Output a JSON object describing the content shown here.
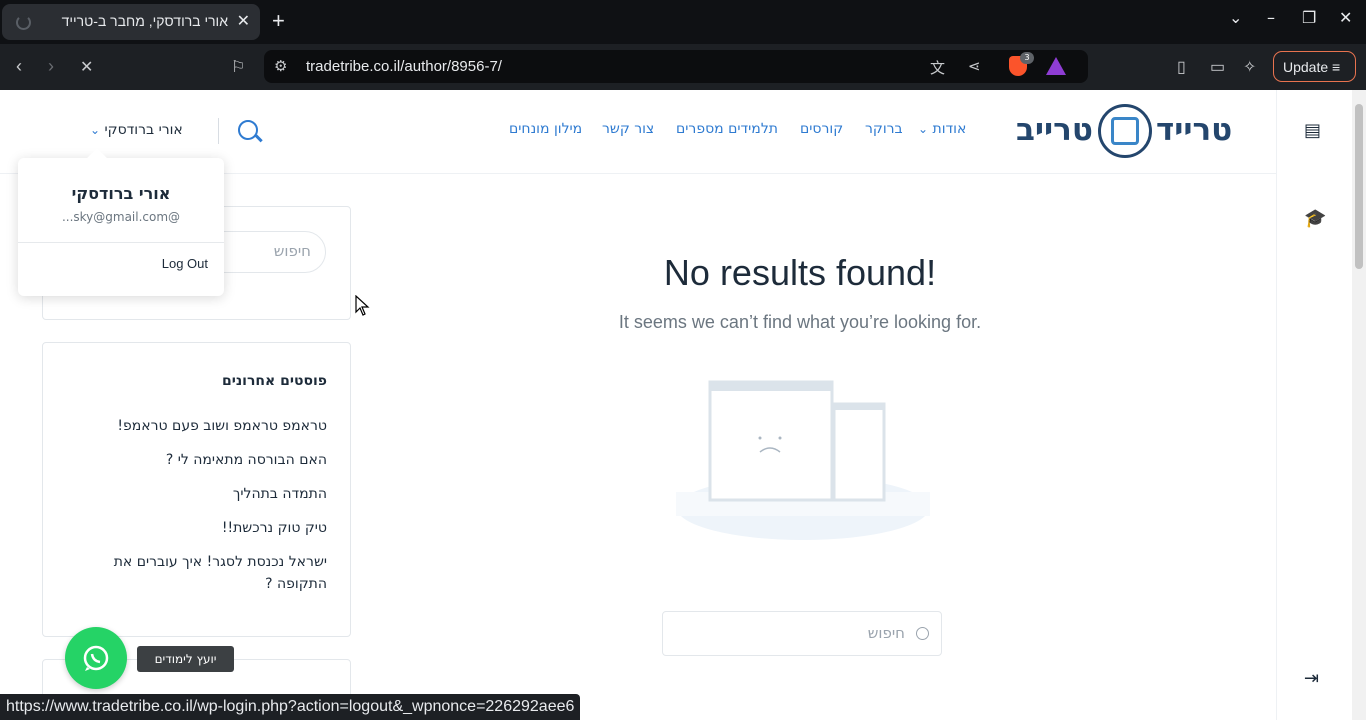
{
  "browser": {
    "tab_title": "אורי ברודסקי, מחבר ב-טרייד",
    "url": "tradetribe.co.il/author/8956-7/",
    "update_label": "Update",
    "brave_badge_count": "3",
    "status_url": "https://www.tradetribe.co.il/wp-login.php?action=logout&_wpnonce=226292aee6"
  },
  "site": {
    "logo_word1": "טרייד",
    "logo_word2": "טרייב",
    "nav": {
      "about": "אודות",
      "broker": "ברוקר",
      "courses": "קורסים",
      "students_tell": "תלמידים מספרים",
      "contact": "צור קשר",
      "glossary": "מילון מונחים"
    },
    "user_name": "אורי ברודסקי"
  },
  "dropdown": {
    "name": "אורי ברודסקי",
    "email": "...sky@gmail.com@",
    "logout": "Log Out"
  },
  "sidebar": {
    "search_placeholder": "חיפוש",
    "recent_title": "פוסטים אחרונים",
    "posts": [
      "טראמפ טראמפ ושוב פעם טראמפ!",
      "האם הבורסה מתאימה לי ?",
      "התמדה בתהליך",
      "טיק טוק נרכשת!!",
      "ישראל נכנסת לסגר! איך עוברים את התקופה ?"
    ]
  },
  "main": {
    "title": "No results found!",
    "subtitle": "It seems we can’t find what you’re looking for.",
    "search_placeholder": "חיפוש"
  },
  "whatsapp": {
    "tooltip": "יועץ לימודים"
  },
  "colors": {
    "brand_dark": "#24466d",
    "brand_blue": "#2f7bd1",
    "whatsapp": "#25d366"
  }
}
